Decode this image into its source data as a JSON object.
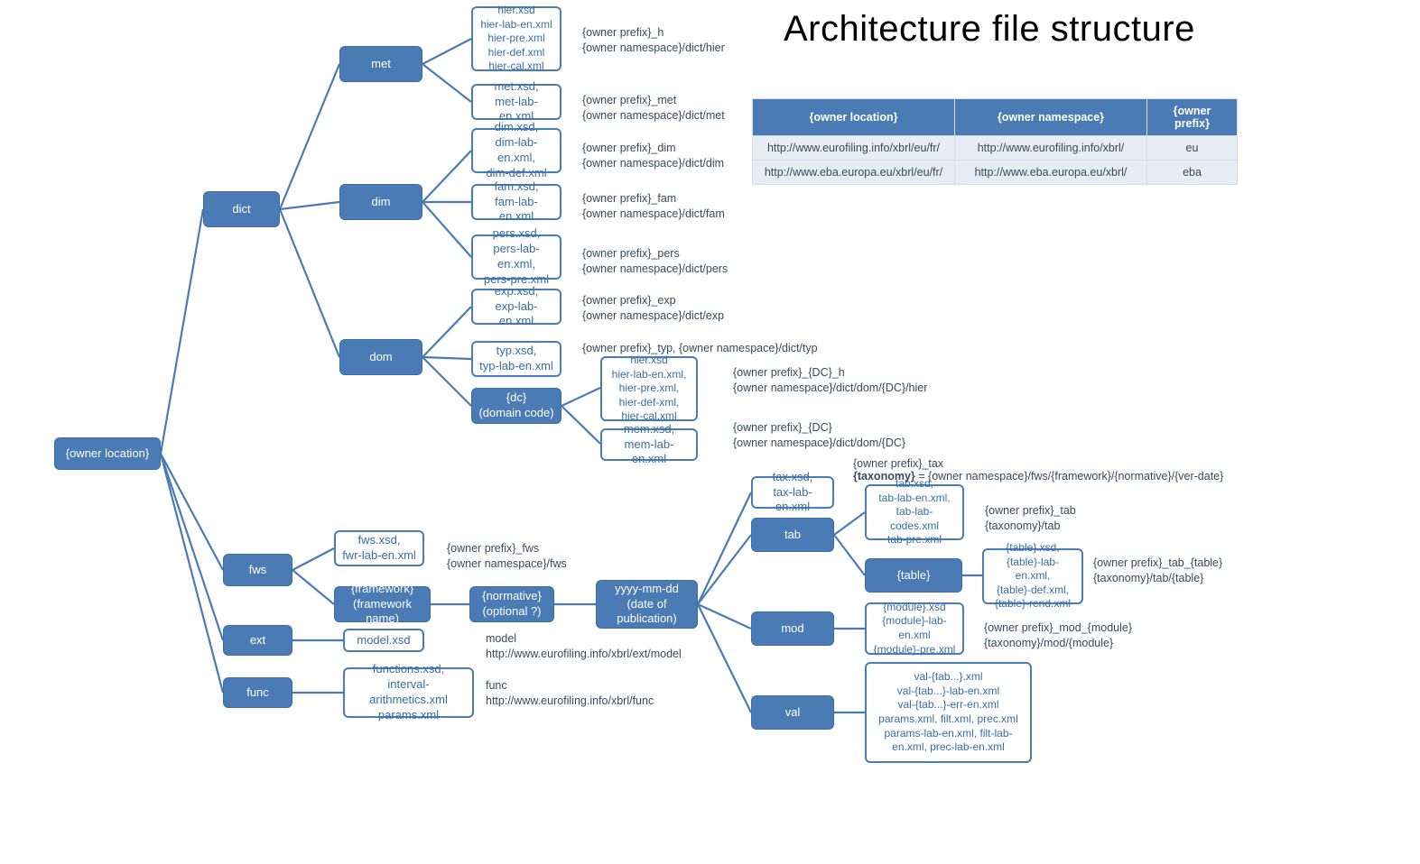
{
  "title": "Architecture file structure",
  "table": {
    "headers": [
      "{owner location}",
      "{owner namespace}",
      "{owner prefix}"
    ],
    "rows": [
      [
        "http://www.eurofiling.info/xbrl/eu/fr/",
        "http://www.eurofiling.info/xbrl/",
        "eu"
      ],
      [
        "http://www.eba.europa.eu/xbrl/eu/fr/",
        "http://www.eba.europa.eu/xbrl/",
        "eba"
      ]
    ]
  },
  "nodes": {
    "root": "{owner location}",
    "dict": "dict",
    "fws": "fws",
    "ext": "ext",
    "func": "func",
    "met": "met",
    "dim": "dim",
    "dom": "dom",
    "hier_files": "hier.xsd\nhier-lab-en.xml\nhier-pre.xml\nhier-def.xml\nhier-cal.xml",
    "met_files": "met.xsd,\nmet-lab-en.xml",
    "dim_files": "dim.xsd,\ndim-lab-en.xml,\ndim-def.xml",
    "fam_files": "fam.xsd,\nfam-lab-en.xml",
    "pers_files": "pers.xsd,\npers-lab-en.xml,\npers-pre.xml",
    "exp_files": "exp.xsd,\nexp-lab-en.xml",
    "typ_files": "typ.xsd,\ntyp-lab-en.xml",
    "dc": "{dc}\n(domain code)",
    "dc_hier": "hier.xsd\nhier-lab-en.xml,\nhier-pre.xml,\nhier-def-xml,\nhier-cal.xml",
    "dc_mem": "mem.xsd,\nmem-lab-en.xml",
    "fws_files": "fws.xsd,\nfwr-lab-en.xml",
    "framework": "{framework}\n(framework name)",
    "normative": "{normative}\n(optional ?)",
    "date": "yyyy-mm-dd\n(date of\npublication)",
    "model": "model.xsd",
    "functions": "functions.xsd,\ninterval-arithmetics.xml\nparams.xml",
    "tax_files": "tax.xsd,\ntax-lab-en.xml",
    "tab": "tab",
    "mod": "mod",
    "val": "val",
    "tab_files": "tab.xsd,\ntab-lab-en.xml,\ntab-lab-codes.xml\ntab-pre.xml",
    "table": "{table}",
    "table_files": "{table}.xsd,\n{table}-lab-en.xml,\n{table}-def.xml,\n{table}-rend.xml",
    "mod_files": "{module}.xsd\n{module}-lab-en.xml\n{module}-pre.xml",
    "val_files": "val-{tab...}.xml\nval-{tab...}-lab-en.xml\nval-{tab...}-err-en.xml\nparams.xml, filt.xml, prec.xml\nparams-lab-en.xml, filt-lab-en.xml, prec-lab-en.xml"
  },
  "labels": {
    "hier": "{owner prefix}_h\n{owner namespace}/dict/hier",
    "met": "{owner prefix}_met\n{owner namespace}/dict/met",
    "dim": "{owner prefix}_dim\n{owner namespace}/dict/dim",
    "fam": "{owner prefix}_fam\n{owner namespace}/dict/fam",
    "pers": "{owner prefix}_pers\n{owner namespace}/dict/pers",
    "exp": "{owner prefix}_exp\n{owner namespace}/dict/exp",
    "typ": "{owner prefix}_typ, {owner namespace}/dict/typ",
    "dc_hier": "{owner prefix}_{DC}_h\n{owner namespace}/dict/dom/{DC}/hier",
    "dc_mem": "{owner prefix}_{DC}\n{owner namespace}/dict/dom/{DC}",
    "fws": "{owner prefix}_fws\n{owner namespace}/fws",
    "model": "model\nhttp://www.eurofiling.info/xbrl/ext/model",
    "func": "func\nhttp://www.eurofiling.info/xbrl/func",
    "tax_prefix": "{owner prefix}_tax",
    "tax_l": "{taxonomy}",
    "tax_r": " = {owner namespace}/fws/{framework}/{normative}/{ver-date}",
    "tab": "{owner prefix}_tab\n{taxonomy}/tab",
    "table": "{owner prefix}_tab_{table}\n{taxonomy}/tab/{table}",
    "mod": "{owner prefix}_mod_{module}\n{taxonomy}/mod/{module}"
  }
}
